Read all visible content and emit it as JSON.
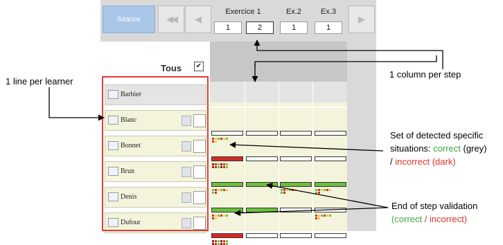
{
  "toolbar": {
    "seance_label": "Séance",
    "first_icon": "double-left-arrow-icon",
    "prev_icon": "left-arrow-icon",
    "next_icon": "right-arrow-icon"
  },
  "exercises": [
    {
      "label": "Exercice 1",
      "steps": [
        "1",
        "2"
      ]
    },
    {
      "label": "Ex.2",
      "steps": [
        "1"
      ]
    },
    {
      "label": "Ex.3",
      "steps": [
        "1"
      ]
    }
  ],
  "tous": {
    "label": "Tous",
    "checked": true,
    "check_glyph": "✔"
  },
  "learners": [
    {
      "name": "Barbier",
      "steps": []
    },
    {
      "name": "Blanc",
      "steps": [
        "none",
        "none",
        "none",
        "none"
      ]
    },
    {
      "name": "Bonnet",
      "steps": [
        "incorrect",
        "none",
        "none",
        "none"
      ]
    },
    {
      "name": "Brun",
      "steps": [
        "correct",
        "correct",
        "correct",
        "correct"
      ]
    },
    {
      "name": "Denis",
      "steps": [
        "correct",
        "correct",
        "none",
        "none"
      ]
    },
    {
      "name": "Dufour",
      "steps": [
        "incorrect",
        "none",
        "none",
        "none"
      ]
    }
  ],
  "annotations": {
    "line_per_learner": "1 line per learner",
    "column_per_step": "1 column per step",
    "situations_line1": "Set of detected specific",
    "situations_line2_prefix": "situations: ",
    "situations_correct": "correct",
    "situations_correct_suffix": " (grey)",
    "situations_line3_prefix": "/ ",
    "situations_incorrect": "incorrect (dark)",
    "validation_line1": "End of step validation",
    "validation_open": "(",
    "validation_correct": "correct",
    "validation_sep": " / ",
    "validation_incorrect": "incorrect",
    "validation_close": ")"
  },
  "colors": {
    "correct": "#6bbf3e",
    "incorrect": "#d7291f",
    "annotation_correct": "#3fa53a",
    "annotation_incorrect": "#e0302a",
    "frame": "#e03a32"
  }
}
